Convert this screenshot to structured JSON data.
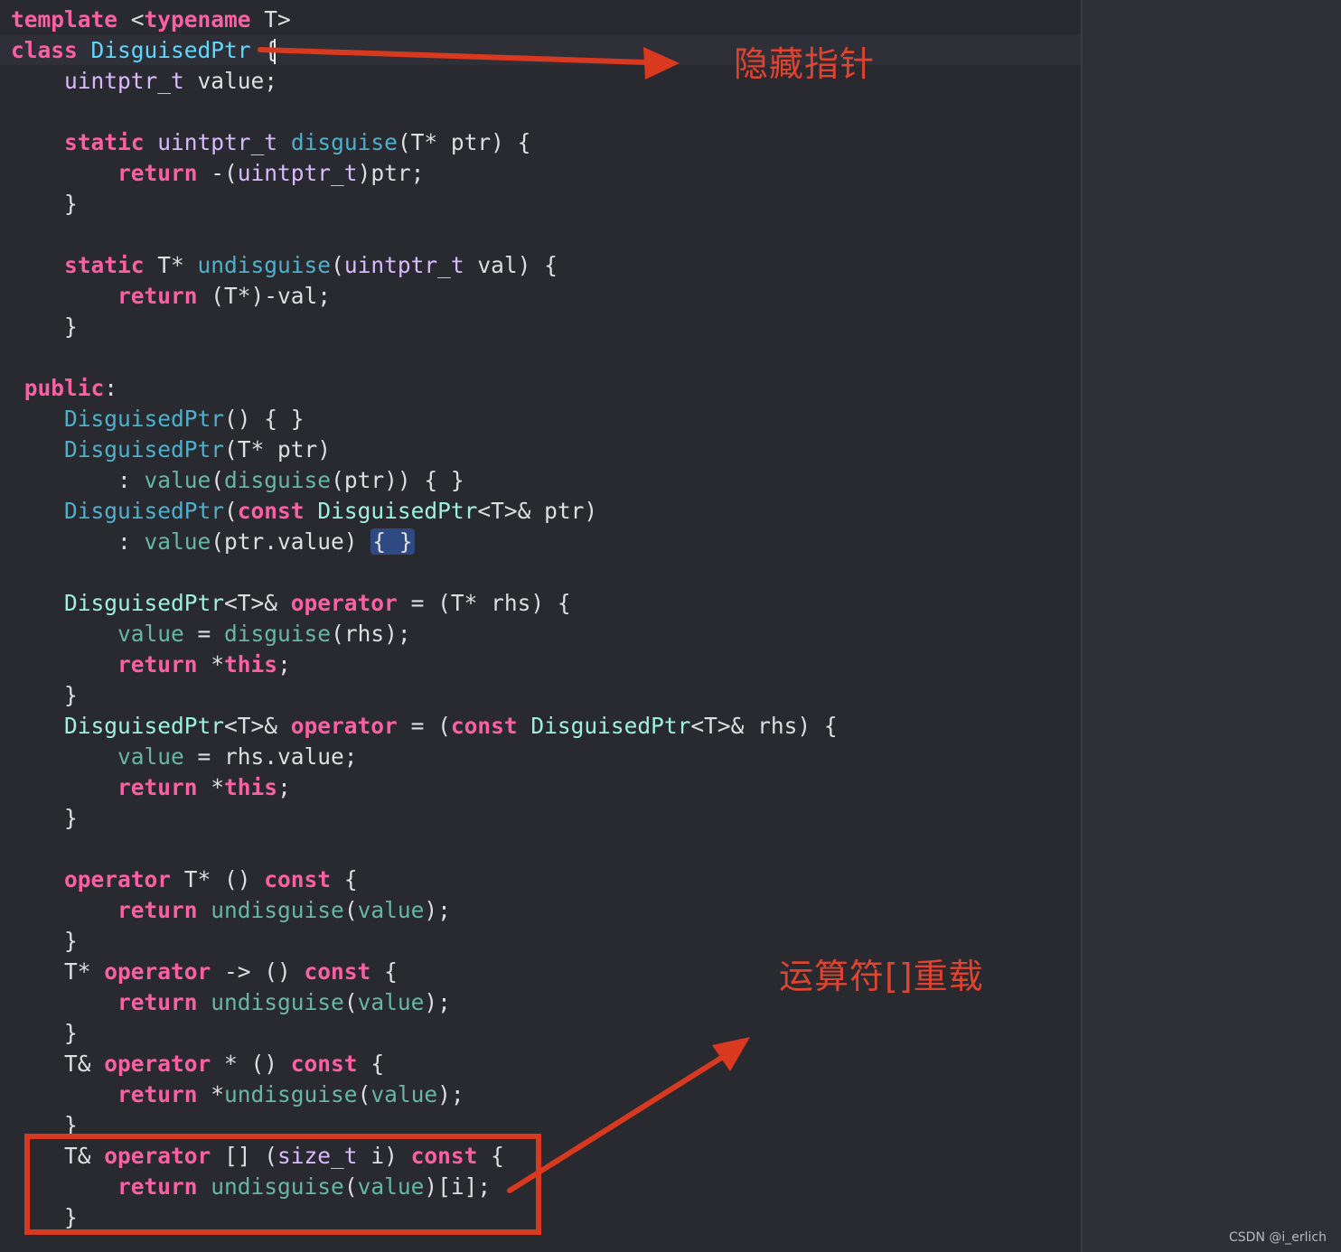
{
  "code": {
    "lines": [
      [
        {
          "t": "template",
          "c": "kw"
        },
        {
          "t": " <",
          "c": "pl"
        },
        {
          "t": "typename",
          "c": "kw"
        },
        {
          "t": " T>",
          "c": "pl"
        }
      ],
      [
        {
          "t": "class",
          "c": "kw"
        },
        {
          "t": " ",
          "c": "pl"
        },
        {
          "t": "DisguisedPtr",
          "c": "cls"
        },
        {
          "t": " {",
          "c": "pl"
        }
      ],
      [
        {
          "t": "    ",
          "c": "pl"
        },
        {
          "t": "uintptr_t",
          "c": "ty"
        },
        {
          "t": " value;",
          "c": "pl"
        }
      ],
      [],
      [
        {
          "t": "    ",
          "c": "pl"
        },
        {
          "t": "static",
          "c": "kw"
        },
        {
          "t": " ",
          "c": "pl"
        },
        {
          "t": "uintptr_t",
          "c": "ty"
        },
        {
          "t": " ",
          "c": "pl"
        },
        {
          "t": "disguise",
          "c": "fd"
        },
        {
          "t": "(T* ptr) {",
          "c": "pl"
        }
      ],
      [
        {
          "t": "        ",
          "c": "pl"
        },
        {
          "t": "return",
          "c": "kw"
        },
        {
          "t": " -(",
          "c": "pl"
        },
        {
          "t": "uintptr_t",
          "c": "ty"
        },
        {
          "t": ")ptr;",
          "c": "pl"
        }
      ],
      [
        {
          "t": "    }",
          "c": "pl"
        }
      ],
      [],
      [
        {
          "t": "    ",
          "c": "pl"
        },
        {
          "t": "static",
          "c": "kw"
        },
        {
          "t": " T* ",
          "c": "pl"
        },
        {
          "t": "undisguise",
          "c": "fd"
        },
        {
          "t": "(",
          "c": "pl"
        },
        {
          "t": "uintptr_t",
          "c": "ty"
        },
        {
          "t": " val) {",
          "c": "pl"
        }
      ],
      [
        {
          "t": "        ",
          "c": "pl"
        },
        {
          "t": "return",
          "c": "kw"
        },
        {
          "t": " (T*)-val;",
          "c": "pl"
        }
      ],
      [
        {
          "t": "    }",
          "c": "pl"
        }
      ],
      [],
      [
        {
          "t": " ",
          "c": "pl"
        },
        {
          "t": "public",
          "c": "kw"
        },
        {
          "t": ":",
          "c": "pl"
        }
      ],
      [
        {
          "t": "    ",
          "c": "pl"
        },
        {
          "t": "DisguisedPtr",
          "c": "fd"
        },
        {
          "t": "() { }",
          "c": "pl"
        }
      ],
      [
        {
          "t": "    ",
          "c": "pl"
        },
        {
          "t": "DisguisedPtr",
          "c": "fd"
        },
        {
          "t": "(T* ptr)",
          "c": "pl"
        }
      ],
      [
        {
          "t": "        : ",
          "c": "pl"
        },
        {
          "t": "value",
          "c": "fn"
        },
        {
          "t": "(",
          "c": "pl"
        },
        {
          "t": "disguise",
          "c": "fn"
        },
        {
          "t": "(ptr)) { }",
          "c": "pl"
        }
      ],
      [
        {
          "t": "    ",
          "c": "pl"
        },
        {
          "t": "DisguisedPtr",
          "c": "fd"
        },
        {
          "t": "(",
          "c": "pl"
        },
        {
          "t": "const",
          "c": "kw"
        },
        {
          "t": " ",
          "c": "pl"
        },
        {
          "t": "DisguisedPtr",
          "c": "td"
        },
        {
          "t": "<T>& ptr)",
          "c": "pl"
        }
      ],
      [
        {
          "t": "        : ",
          "c": "pl"
        },
        {
          "t": "value",
          "c": "fn"
        },
        {
          "t": "(ptr.value) ",
          "c": "pl"
        },
        {
          "t": "{ }",
          "c": "sel"
        }
      ],
      [],
      [
        {
          "t": "    ",
          "c": "pl"
        },
        {
          "t": "DisguisedPtr",
          "c": "td"
        },
        {
          "t": "<T>& ",
          "c": "pl"
        },
        {
          "t": "operator",
          "c": "kw"
        },
        {
          "t": " = (T* rhs) {",
          "c": "pl"
        }
      ],
      [
        {
          "t": "        ",
          "c": "pl"
        },
        {
          "t": "value",
          "c": "fn"
        },
        {
          "t": " = ",
          "c": "pl"
        },
        {
          "t": "disguise",
          "c": "fn"
        },
        {
          "t": "(rhs);",
          "c": "pl"
        }
      ],
      [
        {
          "t": "        ",
          "c": "pl"
        },
        {
          "t": "return",
          "c": "kw"
        },
        {
          "t": " *",
          "c": "pl"
        },
        {
          "t": "this",
          "c": "kw"
        },
        {
          "t": ";",
          "c": "pl"
        }
      ],
      [
        {
          "t": "    }",
          "c": "pl"
        }
      ],
      [
        {
          "t": "    ",
          "c": "pl"
        },
        {
          "t": "DisguisedPtr",
          "c": "td"
        },
        {
          "t": "<T>& ",
          "c": "pl"
        },
        {
          "t": "operator",
          "c": "kw"
        },
        {
          "t": " = (",
          "c": "pl"
        },
        {
          "t": "const",
          "c": "kw"
        },
        {
          "t": " ",
          "c": "pl"
        },
        {
          "t": "DisguisedPtr",
          "c": "td"
        },
        {
          "t": "<T>& rhs) {",
          "c": "pl"
        }
      ],
      [
        {
          "t": "        ",
          "c": "pl"
        },
        {
          "t": "value",
          "c": "fn"
        },
        {
          "t": " = rhs.value;",
          "c": "pl"
        }
      ],
      [
        {
          "t": "        ",
          "c": "pl"
        },
        {
          "t": "return",
          "c": "kw"
        },
        {
          "t": " *",
          "c": "pl"
        },
        {
          "t": "this",
          "c": "kw"
        },
        {
          "t": ";",
          "c": "pl"
        }
      ],
      [
        {
          "t": "    }",
          "c": "pl"
        }
      ],
      [],
      [
        {
          "t": "    ",
          "c": "pl"
        },
        {
          "t": "operator",
          "c": "kw"
        },
        {
          "t": " T* () ",
          "c": "pl"
        },
        {
          "t": "const",
          "c": "kw"
        },
        {
          "t": " {",
          "c": "pl"
        }
      ],
      [
        {
          "t": "        ",
          "c": "pl"
        },
        {
          "t": "return",
          "c": "kw"
        },
        {
          "t": " ",
          "c": "pl"
        },
        {
          "t": "undisguise",
          "c": "fn"
        },
        {
          "t": "(",
          "c": "pl"
        },
        {
          "t": "value",
          "c": "fn"
        },
        {
          "t": ");",
          "c": "pl"
        }
      ],
      [
        {
          "t": "    }",
          "c": "pl"
        }
      ],
      [
        {
          "t": "    T* ",
          "c": "pl"
        },
        {
          "t": "operator",
          "c": "kw"
        },
        {
          "t": " -> () ",
          "c": "pl"
        },
        {
          "t": "const",
          "c": "kw"
        },
        {
          "t": " {",
          "c": "pl"
        }
      ],
      [
        {
          "t": "        ",
          "c": "pl"
        },
        {
          "t": "return",
          "c": "kw"
        },
        {
          "t": " ",
          "c": "pl"
        },
        {
          "t": "undisguise",
          "c": "fn"
        },
        {
          "t": "(",
          "c": "pl"
        },
        {
          "t": "value",
          "c": "fn"
        },
        {
          "t": ");",
          "c": "pl"
        }
      ],
      [
        {
          "t": "    }",
          "c": "pl"
        }
      ],
      [
        {
          "t": "    T& ",
          "c": "pl"
        },
        {
          "t": "operator",
          "c": "kw"
        },
        {
          "t": " * () ",
          "c": "pl"
        },
        {
          "t": "const",
          "c": "kw"
        },
        {
          "t": " {",
          "c": "pl"
        }
      ],
      [
        {
          "t": "        ",
          "c": "pl"
        },
        {
          "t": "return",
          "c": "kw"
        },
        {
          "t": " *",
          "c": "pl"
        },
        {
          "t": "undisguise",
          "c": "fn"
        },
        {
          "t": "(",
          "c": "pl"
        },
        {
          "t": "value",
          "c": "fn"
        },
        {
          "t": ");",
          "c": "pl"
        }
      ],
      [
        {
          "t": "    }",
          "c": "pl"
        }
      ],
      [
        {
          "t": "    T& ",
          "c": "pl"
        },
        {
          "t": "operator",
          "c": "kw"
        },
        {
          "t": " [] (",
          "c": "pl"
        },
        {
          "t": "size_t",
          "c": "ty"
        },
        {
          "t": " i) ",
          "c": "pl"
        },
        {
          "t": "const",
          "c": "kw"
        },
        {
          "t": " {",
          "c": "pl"
        }
      ],
      [
        {
          "t": "        ",
          "c": "pl"
        },
        {
          "t": "return",
          "c": "kw"
        },
        {
          "t": " ",
          "c": "pl"
        },
        {
          "t": "undisguise",
          "c": "fn"
        },
        {
          "t": "(",
          "c": "pl"
        },
        {
          "t": "value",
          "c": "fn"
        },
        {
          "t": ")[i];",
          "c": "pl"
        }
      ],
      [
        {
          "t": "    }",
          "c": "pl"
        }
      ]
    ]
  },
  "annotations": {
    "hide_pointer": "隐藏指针",
    "operator_overload": "运算符[]重载"
  },
  "credit": "CSDN @i_erlich",
  "colors": {
    "annotation_red": "#e0432f",
    "background": "#292a30",
    "keyword": "#fc5fa3",
    "type": "#dabaff",
    "function": "#67b7a4",
    "class_name": "#5dd8ff"
  }
}
